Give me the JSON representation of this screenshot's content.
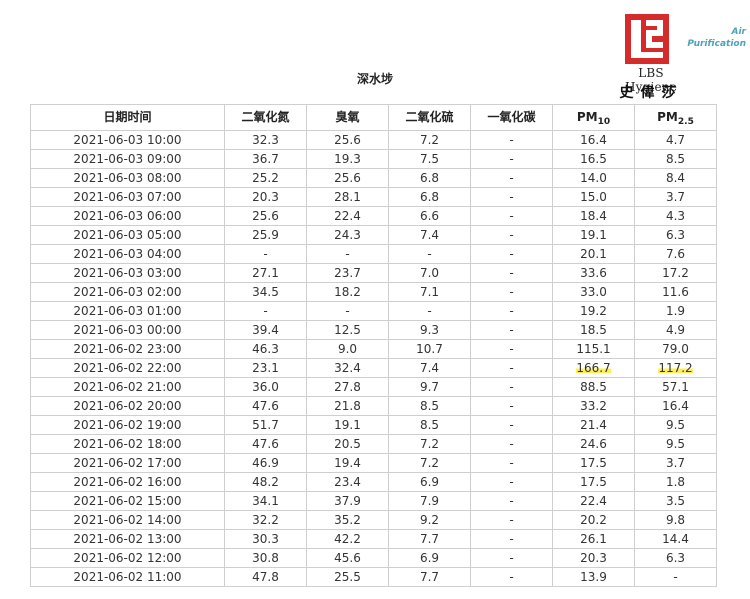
{
  "brand": {
    "name": "LBS Hygiene",
    "name_cn": "史偉莎",
    "tagline_line1": "Air",
    "tagline_line2": "Purification",
    "logo_color": "#d62b2b",
    "tagline_color": "#4aa3b8"
  },
  "station": "深水埗",
  "headers": {
    "datetime": "日期时间",
    "no2": "二氧化氮",
    "o3": "臭氧",
    "so2": "二氧化硫",
    "co": "一氧化碳",
    "pm10_base": "PM",
    "pm10_sub": "10",
    "pm25_base": "PM",
    "pm25_sub": "2.5"
  },
  "highlight_color": "#ffee58",
  "rows": [
    {
      "time": "2021-06-03 10:00",
      "no2": "32.3",
      "o3": "25.6",
      "so2": "7.2",
      "co": "-",
      "pm10": "16.4",
      "pm25": "4.7"
    },
    {
      "time": "2021-06-03 09:00",
      "no2": "36.7",
      "o3": "19.3",
      "so2": "7.5",
      "co": "-",
      "pm10": "16.5",
      "pm25": "8.5"
    },
    {
      "time": "2021-06-03 08:00",
      "no2": "25.2",
      "o3": "25.6",
      "so2": "6.8",
      "co": "-",
      "pm10": "14.0",
      "pm25": "8.4"
    },
    {
      "time": "2021-06-03 07:00",
      "no2": "20.3",
      "o3": "28.1",
      "so2": "6.8",
      "co": "-",
      "pm10": "15.0",
      "pm25": "3.7"
    },
    {
      "time": "2021-06-03 06:00",
      "no2": "25.6",
      "o3": "22.4",
      "so2": "6.6",
      "co": "-",
      "pm10": "18.4",
      "pm25": "4.3"
    },
    {
      "time": "2021-06-03 05:00",
      "no2": "25.9",
      "o3": "24.3",
      "so2": "7.4",
      "co": "-",
      "pm10": "19.1",
      "pm25": "6.3"
    },
    {
      "time": "2021-06-03 04:00",
      "no2": "-",
      "o3": "-",
      "so2": "-",
      "co": "-",
      "pm10": "20.1",
      "pm25": "7.6"
    },
    {
      "time": "2021-06-03 03:00",
      "no2": "27.1",
      "o3": "23.7",
      "so2": "7.0",
      "co": "-",
      "pm10": "33.6",
      "pm25": "17.2"
    },
    {
      "time": "2021-06-03 02:00",
      "no2": "34.5",
      "o3": "18.2",
      "so2": "7.1",
      "co": "-",
      "pm10": "33.0",
      "pm25": "11.6"
    },
    {
      "time": "2021-06-03 01:00",
      "no2": "-",
      "o3": "-",
      "so2": "-",
      "co": "-",
      "pm10": "19.2",
      "pm25": "1.9"
    },
    {
      "time": "2021-06-03 00:00",
      "no2": "39.4",
      "o3": "12.5",
      "so2": "9.3",
      "co": "-",
      "pm10": "18.5",
      "pm25": "4.9"
    },
    {
      "time": "2021-06-02 23:00",
      "no2": "46.3",
      "o3": "9.0",
      "so2": "10.7",
      "co": "-",
      "pm10": "115.1",
      "pm25": "79.0"
    },
    {
      "time": "2021-06-02 22:00",
      "no2": "23.1",
      "o3": "32.4",
      "so2": "7.4",
      "co": "-",
      "pm10": "166.7",
      "pm25": "117.2",
      "highlight": true
    },
    {
      "time": "2021-06-02 21:00",
      "no2": "36.0",
      "o3": "27.8",
      "so2": "9.7",
      "co": "-",
      "pm10": "88.5",
      "pm25": "57.1"
    },
    {
      "time": "2021-06-02 20:00",
      "no2": "47.6",
      "o3": "21.8",
      "so2": "8.5",
      "co": "-",
      "pm10": "33.2",
      "pm25": "16.4"
    },
    {
      "time": "2021-06-02 19:00",
      "no2": "51.7",
      "o3": "19.1",
      "so2": "8.5",
      "co": "-",
      "pm10": "21.4",
      "pm25": "9.5"
    },
    {
      "time": "2021-06-02 18:00",
      "no2": "47.6",
      "o3": "20.5",
      "so2": "7.2",
      "co": "-",
      "pm10": "24.6",
      "pm25": "9.5"
    },
    {
      "time": "2021-06-02 17:00",
      "no2": "46.9",
      "o3": "19.4",
      "so2": "7.2",
      "co": "-",
      "pm10": "17.5",
      "pm25": "3.7"
    },
    {
      "time": "2021-06-02 16:00",
      "no2": "48.2",
      "o3": "23.4",
      "so2": "6.9",
      "co": "-",
      "pm10": "17.5",
      "pm25": "1.8"
    },
    {
      "time": "2021-06-02 15:00",
      "no2": "34.1",
      "o3": "37.9",
      "so2": "7.9",
      "co": "-",
      "pm10": "22.4",
      "pm25": "3.5"
    },
    {
      "time": "2021-06-02 14:00",
      "no2": "32.2",
      "o3": "35.2",
      "so2": "9.2",
      "co": "-",
      "pm10": "20.2",
      "pm25": "9.8"
    },
    {
      "time": "2021-06-02 13:00",
      "no2": "30.3",
      "o3": "42.2",
      "so2": "7.7",
      "co": "-",
      "pm10": "26.1",
      "pm25": "14.4"
    },
    {
      "time": "2021-06-02 12:00",
      "no2": "30.8",
      "o3": "45.6",
      "so2": "6.9",
      "co": "-",
      "pm10": "20.3",
      "pm25": "6.3"
    },
    {
      "time": "2021-06-02 11:00",
      "no2": "47.8",
      "o3": "25.5",
      "so2": "7.7",
      "co": "-",
      "pm10": "13.9",
      "pm25": "-"
    }
  ]
}
